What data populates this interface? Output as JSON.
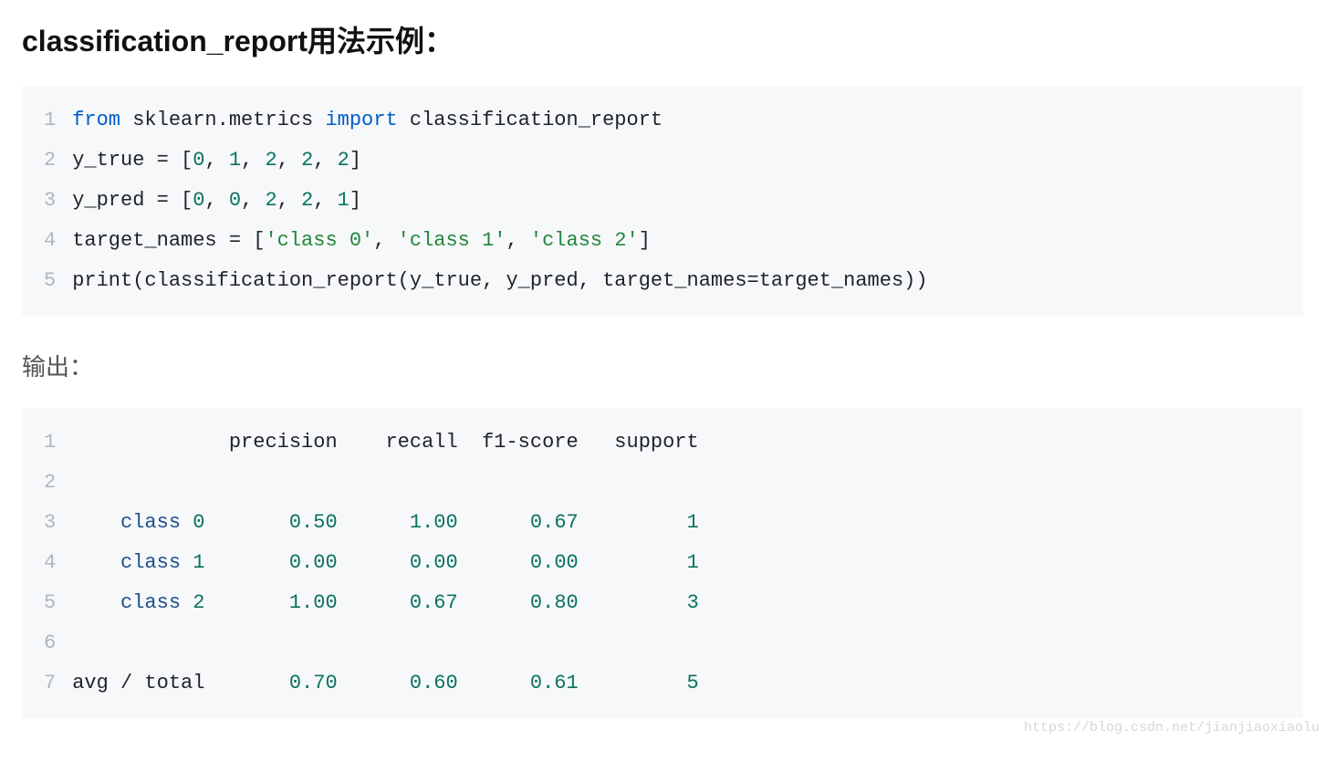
{
  "heading": "classification_report用法示例：",
  "code1": {
    "linenos": [
      "1",
      "2",
      "3",
      "4",
      "5"
    ],
    "lines": [
      [
        {
          "t": "from",
          "c": "kw"
        },
        {
          "t": " sklearn.metrics ",
          "c": ""
        },
        {
          "t": "import",
          "c": "kw"
        },
        {
          "t": " classification_report",
          "c": ""
        }
      ],
      [
        {
          "t": "y_true = [",
          "c": ""
        },
        {
          "t": "0",
          "c": "num"
        },
        {
          "t": ", ",
          "c": ""
        },
        {
          "t": "1",
          "c": "num"
        },
        {
          "t": ", ",
          "c": ""
        },
        {
          "t": "2",
          "c": "num"
        },
        {
          "t": ", ",
          "c": ""
        },
        {
          "t": "2",
          "c": "num"
        },
        {
          "t": ", ",
          "c": ""
        },
        {
          "t": "2",
          "c": "num"
        },
        {
          "t": "]",
          "c": ""
        }
      ],
      [
        {
          "t": "y_pred = [",
          "c": ""
        },
        {
          "t": "0",
          "c": "num"
        },
        {
          "t": ", ",
          "c": ""
        },
        {
          "t": "0",
          "c": "num"
        },
        {
          "t": ", ",
          "c": ""
        },
        {
          "t": "2",
          "c": "num"
        },
        {
          "t": ", ",
          "c": ""
        },
        {
          "t": "2",
          "c": "num"
        },
        {
          "t": ", ",
          "c": ""
        },
        {
          "t": "1",
          "c": "num"
        },
        {
          "t": "]",
          "c": ""
        }
      ],
      [
        {
          "t": "target_names = [",
          "c": ""
        },
        {
          "t": "'class 0'",
          "c": "str"
        },
        {
          "t": ", ",
          "c": ""
        },
        {
          "t": "'class 1'",
          "c": "str"
        },
        {
          "t": ", ",
          "c": ""
        },
        {
          "t": "'class 2'",
          "c": "str"
        },
        {
          "t": "]",
          "c": ""
        }
      ],
      [
        {
          "t": "print(classification_report(y_true, y_pred, target_names=target_names))",
          "c": ""
        }
      ]
    ]
  },
  "outputLabel": "输出：",
  "code2": {
    "linenos": [
      "1",
      "2",
      "3",
      "4",
      "5",
      "6",
      "7"
    ],
    "lines": [
      [
        {
          "t": "             precision    recall  f1-score   support",
          "c": ""
        }
      ],
      [
        {
          "t": "",
          "c": ""
        }
      ],
      [
        {
          "t": "    ",
          "c": ""
        },
        {
          "t": "class",
          "c": "cls"
        },
        {
          "t": " ",
          "c": ""
        },
        {
          "t": "0",
          "c": "num"
        },
        {
          "t": "       ",
          "c": ""
        },
        {
          "t": "0.50",
          "c": "num"
        },
        {
          "t": "      ",
          "c": ""
        },
        {
          "t": "1.00",
          "c": "num"
        },
        {
          "t": "      ",
          "c": ""
        },
        {
          "t": "0.67",
          "c": "num"
        },
        {
          "t": "         ",
          "c": ""
        },
        {
          "t": "1",
          "c": "num"
        }
      ],
      [
        {
          "t": "    ",
          "c": ""
        },
        {
          "t": "class",
          "c": "cls"
        },
        {
          "t": " ",
          "c": ""
        },
        {
          "t": "1",
          "c": "num"
        },
        {
          "t": "       ",
          "c": ""
        },
        {
          "t": "0.00",
          "c": "num"
        },
        {
          "t": "      ",
          "c": ""
        },
        {
          "t": "0.00",
          "c": "num"
        },
        {
          "t": "      ",
          "c": ""
        },
        {
          "t": "0.00",
          "c": "num"
        },
        {
          "t": "         ",
          "c": ""
        },
        {
          "t": "1",
          "c": "num"
        }
      ],
      [
        {
          "t": "    ",
          "c": ""
        },
        {
          "t": "class",
          "c": "cls"
        },
        {
          "t": " ",
          "c": ""
        },
        {
          "t": "2",
          "c": "num"
        },
        {
          "t": "       ",
          "c": ""
        },
        {
          "t": "1.00",
          "c": "num"
        },
        {
          "t": "      ",
          "c": ""
        },
        {
          "t": "0.67",
          "c": "num"
        },
        {
          "t": "      ",
          "c": ""
        },
        {
          "t": "0.80",
          "c": "num"
        },
        {
          "t": "         ",
          "c": ""
        },
        {
          "t": "3",
          "c": "num"
        }
      ],
      [
        {
          "t": "",
          "c": ""
        }
      ],
      [
        {
          "t": "avg / total       ",
          "c": ""
        },
        {
          "t": "0.70",
          "c": "num"
        },
        {
          "t": "      ",
          "c": ""
        },
        {
          "t": "0.60",
          "c": "num"
        },
        {
          "t": "      ",
          "c": ""
        },
        {
          "t": "0.61",
          "c": "num"
        },
        {
          "t": "         ",
          "c": ""
        },
        {
          "t": "5",
          "c": "num"
        }
      ]
    ]
  },
  "watermark": "https://blog.csdn.net/jianjiaoxiaolu",
  "chart_data": {
    "type": "table",
    "title": "classification_report",
    "columns": [
      "class",
      "precision",
      "recall",
      "f1-score",
      "support"
    ],
    "rows": [
      [
        "class 0",
        0.5,
        1.0,
        0.67,
        1
      ],
      [
        "class 1",
        0.0,
        0.0,
        0.0,
        1
      ],
      [
        "class 2",
        1.0,
        0.67,
        0.8,
        3
      ],
      [
        "avg / total",
        0.7,
        0.6,
        0.61,
        5
      ]
    ]
  }
}
